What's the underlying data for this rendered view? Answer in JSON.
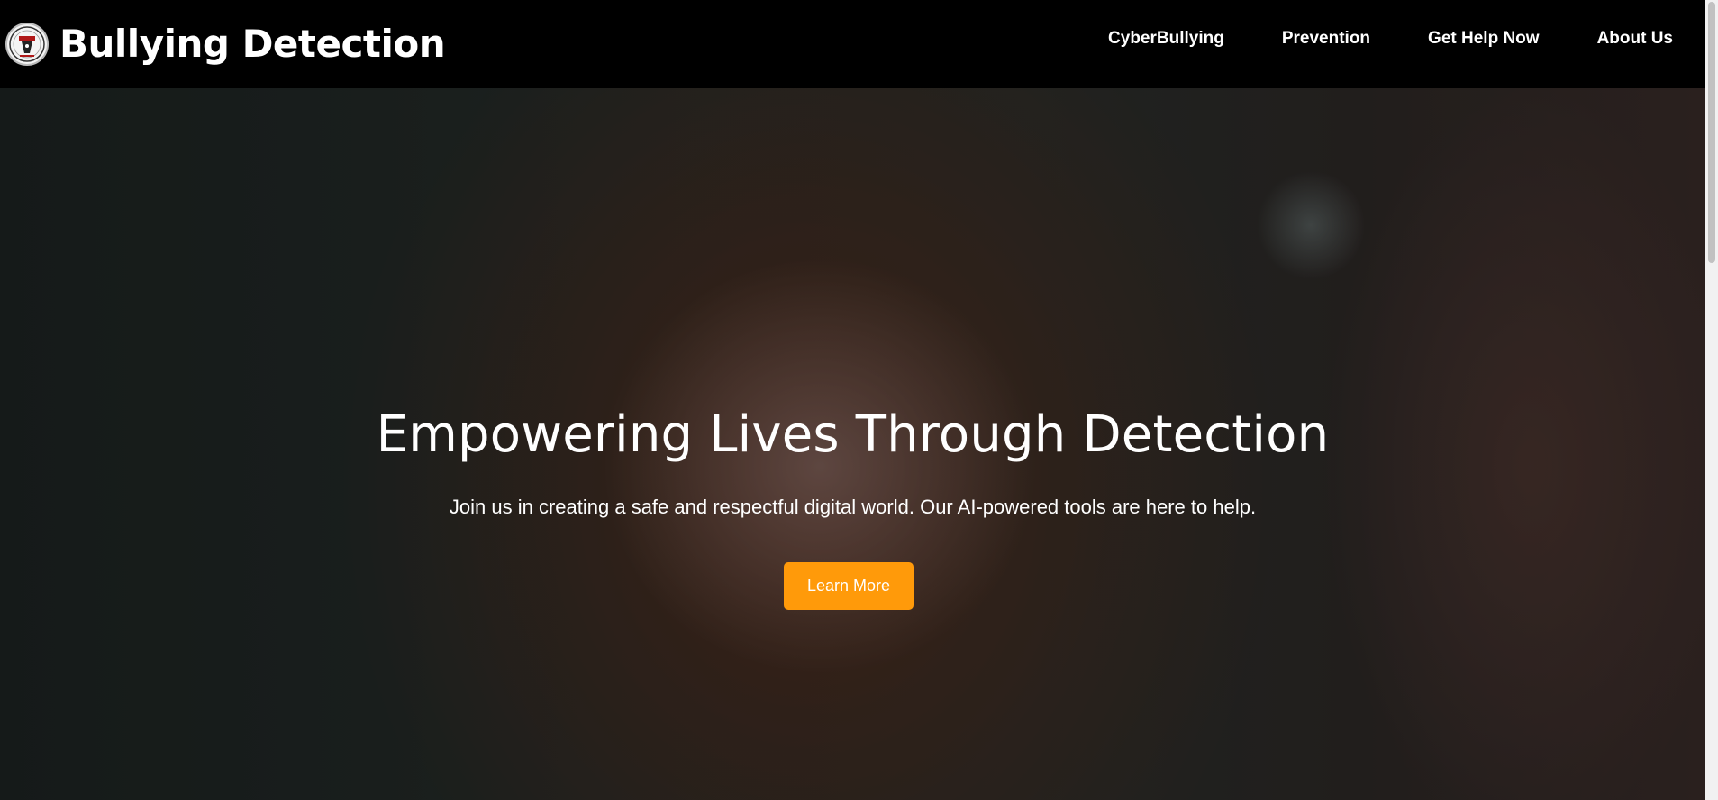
{
  "brand": {
    "title": "Bullying Detection",
    "logo_icon": "crest-logo-icon"
  },
  "nav": {
    "items": [
      {
        "label": "CyberBullying"
      },
      {
        "label": "Prevention"
      },
      {
        "label": "Get Help Now"
      },
      {
        "label": "About Us"
      }
    ]
  },
  "hero": {
    "title": "Empowering Lives Through Detection",
    "subtitle": "Join us in creating a safe and respectful digital world. Our AI-powered tools are here to help.",
    "cta_label": "Learn More",
    "background_image": "portrait-photo"
  },
  "colors": {
    "navbar_bg": "#000000",
    "cta_bg": "#ff9a0a",
    "text": "#ffffff"
  }
}
